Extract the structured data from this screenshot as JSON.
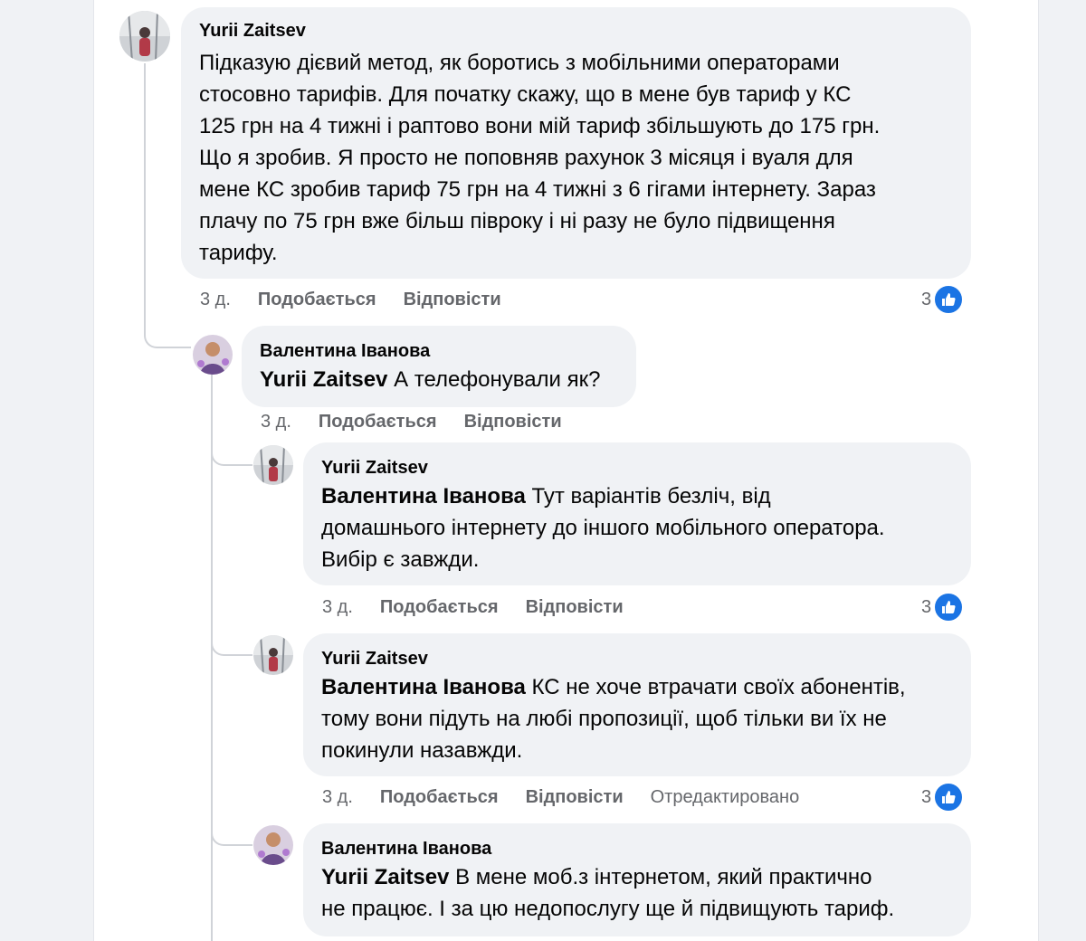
{
  "comments": [
    {
      "author": "Yurii Zaitsev",
      "lines": [
        "Підказую дієвий метод, як боротись з мобільними операторами",
        "стосовно тарифів. Для початку скажу, що в мене був тариф у КС",
        "125 грн на 4 тижні і раптово вони мій тариф збільшують до 175 грн.",
        "Що я зробив. Я просто не поповняв рахунок 3 місяця і вуаля для",
        "мене КС зробив тариф 75 грн на 4 тижні з 6 гігами інтернету. Зараз",
        "плачу по 75 грн вже більш півроку і ні разу не було підвищення",
        "тарифу."
      ],
      "time": "3 д.",
      "like_label": "Подобається",
      "reply_label": "Відповісти",
      "reaction_count": "3"
    },
    {
      "author": "Валентина Іванова",
      "mention": "Yurii Zaitsev",
      "rest": " А телефонували як?",
      "time": "3 д.",
      "like_label": "Подобається",
      "reply_label": "Відповісти"
    },
    {
      "author": "Yurii Zaitsev",
      "mention": "Валентина Іванова",
      "line1_rest": " Тут варіантів безліч, від",
      "line2": "домашнього інтернету до іншого мобільного оператора.",
      "line3": "Вибір є завжди.",
      "time": "3 д.",
      "like_label": "Подобається",
      "reply_label": "Відповісти",
      "reaction_count": "3"
    },
    {
      "author": "Yurii Zaitsev",
      "mention": "Валентина Іванова",
      "line1_rest": " КС не хоче втрачати своїх абонентів,",
      "line2": "тому вони підуть на любі пропозиції, щоб тільки ви їх не",
      "line3": "покинули назавжди.",
      "time": "3 д.",
      "like_label": "Подобається",
      "reply_label": "Відповісти",
      "edited_label": "Отредактировано",
      "reaction_count": "3"
    },
    {
      "author": "Валентина Іванова",
      "mention": "Yurii Zaitsev",
      "line1_rest": " В мене моб.з інтернетом, який практично",
      "line2": "не працює. І за цю недопослугу ще й підвищують тариф."
    }
  ],
  "icons": {
    "like": "thumbs-up-icon"
  },
  "colors": {
    "like_blue": "#1b74e4",
    "bubble": "#f0f2f5",
    "meta": "#65676b"
  }
}
